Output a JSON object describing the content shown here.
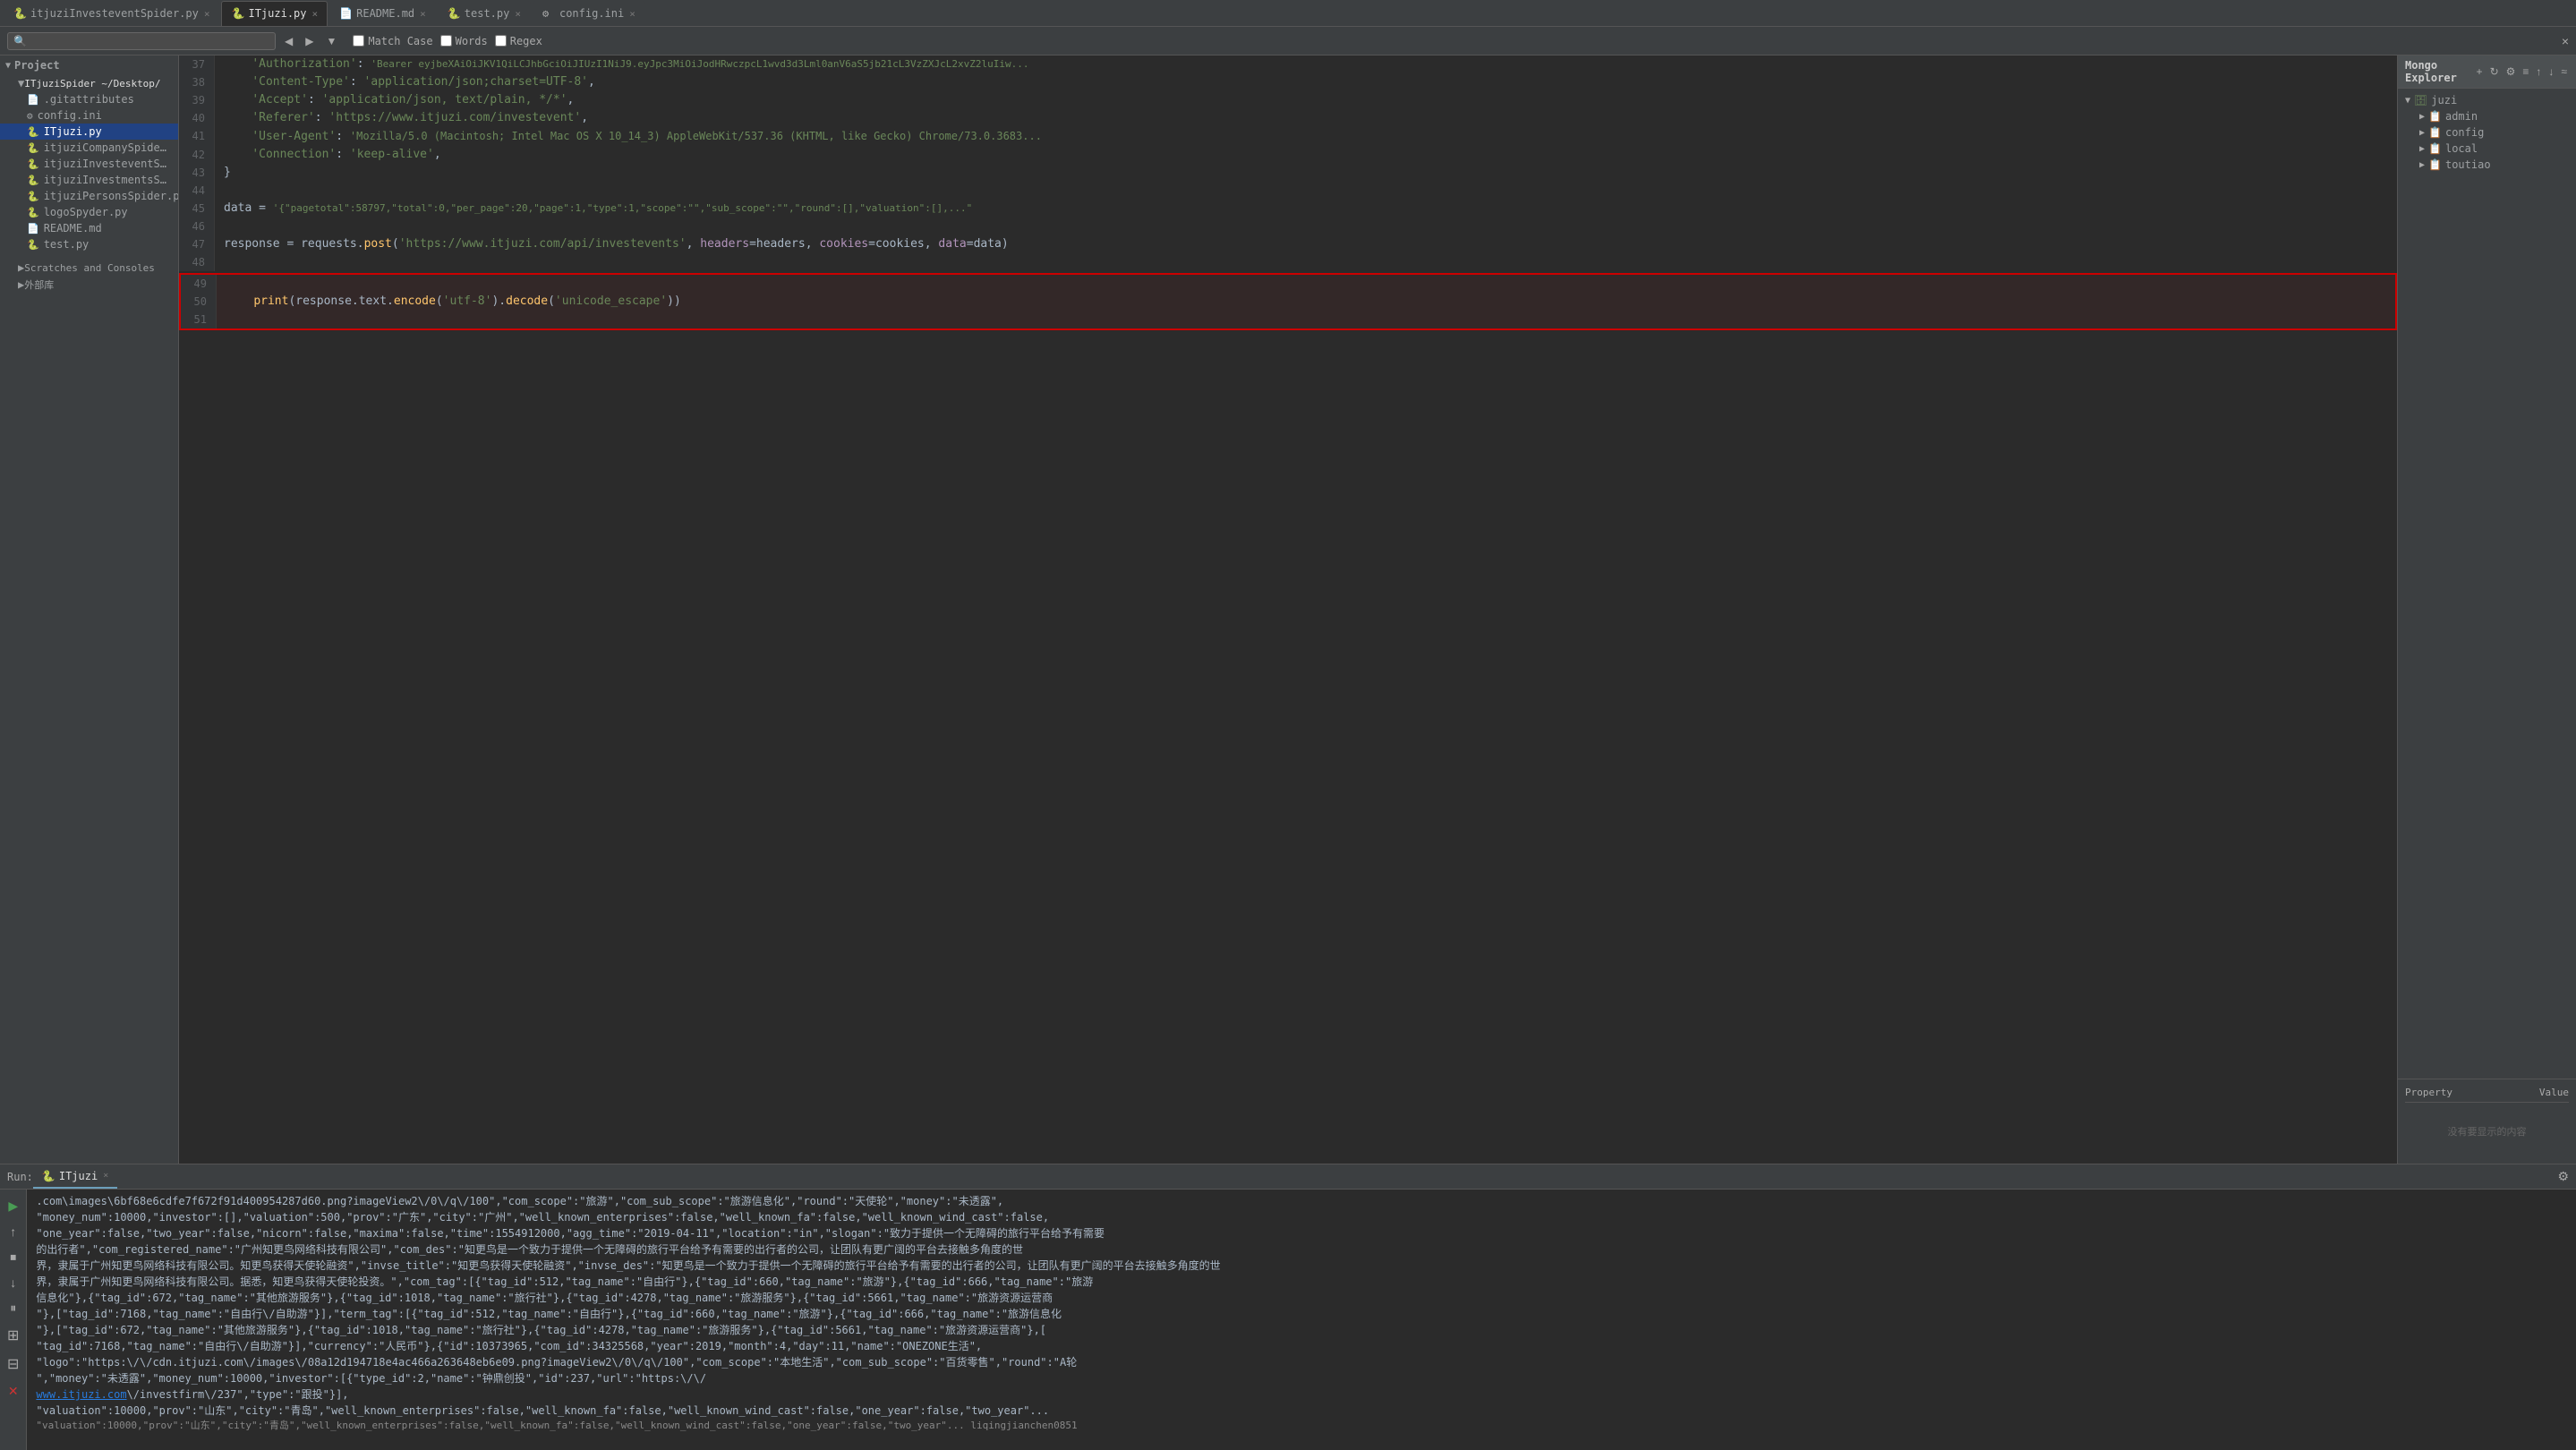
{
  "tabs": [
    {
      "label": "itjuziInvesteventSpider.py",
      "icon": "py",
      "active": false,
      "closeable": true
    },
    {
      "label": "ITjuzi.py",
      "icon": "py",
      "active": true,
      "closeable": true
    },
    {
      "label": "README.md",
      "icon": "md",
      "active": false,
      "closeable": true
    },
    {
      "label": "test.py",
      "icon": "py",
      "active": false,
      "closeable": true
    },
    {
      "label": "config.ini",
      "icon": "ini",
      "active": false,
      "closeable": true
    }
  ],
  "search": {
    "placeholder": "",
    "value": "",
    "match_case_label": "Match Case",
    "words_label": "Words",
    "regex_label": "Regex"
  },
  "sidebar": {
    "project_label": "Project",
    "root_label": "ITjuziSpider ~/Desktop/",
    "items": [
      {
        "label": ".gitattributes",
        "level": 2,
        "icon": "📄",
        "selected": false
      },
      {
        "label": "config.ini",
        "level": 2,
        "icon": "⚙️",
        "selected": false
      },
      {
        "label": "ITjuzi.py",
        "level": 2,
        "icon": "🐍",
        "selected": true
      },
      {
        "label": "itjuziCompanySpider.p",
        "level": 2,
        "icon": "🐍",
        "selected": false
      },
      {
        "label": "itjuziInvesteventSpide",
        "level": 2,
        "icon": "🐍",
        "selected": false
      },
      {
        "label": "itjuziInvestmentsSpid",
        "level": 2,
        "icon": "🐍",
        "selected": false
      },
      {
        "label": "itjuziPersonsSpider.py",
        "level": 2,
        "icon": "🐍",
        "selected": false
      },
      {
        "label": "logoSpyder.py",
        "level": 2,
        "icon": "🐍",
        "selected": false
      },
      {
        "label": "README.md",
        "level": 2,
        "icon": "📄",
        "selected": false
      },
      {
        "label": "test.py",
        "level": 2,
        "icon": "🐍",
        "selected": false
      }
    ],
    "scratches_label": "Scratches and Consoles",
    "external_label": "外部库"
  },
  "code_lines": [
    {
      "num": 37,
      "content": "    'Authorization': 'Bearer eyjbeXAiOiJKV1QiLCJhbGciOiJIUzI1NiJ9.eyJpc3MiOiJodHRwczpcL1wvd3d3Lml0anV6aS5jb21cL3VzZXJcL2xvZ2luIiw"
    },
    {
      "num": 38,
      "content": "    'Content-Type': 'application/json;charset=UTF-8',"
    },
    {
      "num": 39,
      "content": "    'Accept': 'application/json, text/plain, */*',"
    },
    {
      "num": 40,
      "content": "    'Referer': 'https://www.itjuzi.com/investevent',"
    },
    {
      "num": 41,
      "content": "    'User-Agent': 'Mozilla/5.0 (Macintosh; Intel Mac OS X 10_14_3) AppleWebKit/537.36 (KHTML, like Gecko) Chrome/73.0.3683"
    },
    {
      "num": 42,
      "content": "    'Connection': 'keep-alive',"
    },
    {
      "num": 43,
      "content": "}"
    },
    {
      "num": 44,
      "content": ""
    },
    {
      "num": 45,
      "content": "data = '{\"pagetotal\":58797,\"total\":0,\"per_page\":20,\"page\":1,\"type\":1,\"scope\":\"\",\"sub_scope\":\"\",\"round\":[],\"valuation\":[],\""
    },
    {
      "num": 46,
      "content": ""
    },
    {
      "num": 47,
      "content": "response = requests.post('https://www.itjuzi.com/api/investevents', headers=headers, cookies=cookies, data=data)"
    },
    {
      "num": 48,
      "content": ""
    },
    {
      "num": 49,
      "content": ""
    },
    {
      "num": 50,
      "content": "    print(response.text.encode('utf-8').decode('unicode_escape'))",
      "highlighted": true
    },
    {
      "num": 51,
      "content": ""
    }
  ],
  "mongo_explorer": {
    "title": "Mongo Explorer",
    "toolbar_buttons": [
      "+",
      "↻",
      "⚙",
      "≡",
      "↑",
      "↓",
      "≈"
    ],
    "databases": [
      {
        "name": "juzi",
        "expanded": true,
        "collections": [
          "admin",
          "config",
          "local",
          "toutiao"
        ]
      }
    ]
  },
  "property_panel": {
    "property_label": "Property",
    "value_label": "Value",
    "empty_text": "没有要显示的内容"
  },
  "run_panel": {
    "tab_label": "Run:",
    "run_name": "ITjuzi",
    "output_lines": [
      ".com\\images\\6bf68e6cdfe7f672f91d400954287d60.png?imageView2\\/0\\/q\\/100\",\"com_scope\":\"旅游\",\"com_sub_scope\":\"旅游信息化\",\"round\":\"天使轮\",\"money\":\"未透露\",",
      "\"money_num\":10000,\"investor\":[],\"valuation\":500,\"prov\":\"广东\",\"city\":\"广州\",\"well_known_enterprises\":false,\"well_known_fa\":false,\"well_known_wind_cast\":false,",
      "\"one_year\":false,\"two_year\":false,\"nicorn\":false,\"maxima\":false,\"time\":1554912000,\"agg_time\":\"2019-04-11\",\"location\":\"in\",\"slogan\":\"致力于提供一个无障碍的旅行平台给予有需要",
      "的出行者\",\"com_registered_name\":\"广州知更鸟网络科技有限公司\",\"com_des\":\"知更鸟是一个致力于提供一个无障碍的旅行平台给予有需要的出行者的公司，让团队有更广阔的平台去接触多角度的世",
      "界，隶属于广州知更鸟网络科技有限公司。知更鸟获得天使轮融资\",\"invse_title\":\"知更鸟获得天使轮融资\",\"invse_des\":\"知更鸟是一个致力于提供一个无障碍的旅行平台给予有需要的出行者的公司，让团队有更广阔的平台去接触多角度的世",
      "界，隶属于广州知更鸟网络科技有限公司。据悉，知更鸟获得天使轮投资。\",\"com_tag\":[{\"tag_id\":512,\"tag_name\":\"自由行\"},{\"tag_id\":660,\"tag_name\":\"旅游\"},{\"tag_id\":666,\"tag_name\":\"旅游",
      "信息化\"},{\"tag_id\":672,\"tag_name\":\"其他旅游服务\"},{\"tag_id\":1018,\"tag_name\":\"旅行社\"},{\"tag_id\":4278,\"tag_name\":\"旅游服务\"},{\"tag_id\":5661,\"tag_name\":\"旅游资源运营商",
      "\"},[\"tag_id\":7168,\"tag_name\":\"自由行\\/自助游\"}],\"term_tag\":[{\"tag_id\":512,\"tag_name\":\"自由行\"},{\"tag_id\":660,\"tag_name\":\"旅游\"},{\"tag_id\":666,\"tag_name\":\"旅游信息化",
      "\"},[\"tag_id\":672,\"tag_name\":\"其他旅游服务\"},{\"tag_id\":1018,\"tag_name\":\"旅行社\"},{\"tag_id\":4278,\"tag_name\":\"旅游服务\"},{\"tag_id\":5661,\"tag_name\":\"旅游资源运营商\"},[",
      "\"tag_id\":7168,\"tag_name\":\"自由行\\/自助游\"}],\"currency\":\"人民币\"},{\"id\":10373965,\"com_id\":34325568,\"year\":2019,\"month\":4,\"day\":11,\"name\":\"ONEZONE生活\",",
      "\"logo\":\"https:\\/\\/cdn.itjuzi.com\\/images\\/08a12d194718e4ac466a263648eb6e09.png?imageView2\\/0\\/q\\/100\",\"com_scope\":\"本地生活\",\"com_sub_scope\":\"百货零售\",\"round\":\"A轮",
      "\",\"money\":\"未透露\",\"money_num\":10000,\"investor\":[{\"type_id\":2,\"name\":\"钟鼎创投\",\"id\":237,\"url\":\"https:\\/\\/",
      "www.itjuzi.com\\/investfirm\\/237\",\"type\":\"跟投\"}],",
      "\"valuation\":10000,\"prov\":\"山东\",\"city\":\"青岛\",\"well_known_enterprises\":false,\"well_known_fa\":false,\"well_known_wind_cast\":false,\"one_year\":false,\"two_year\"..."
    ]
  }
}
